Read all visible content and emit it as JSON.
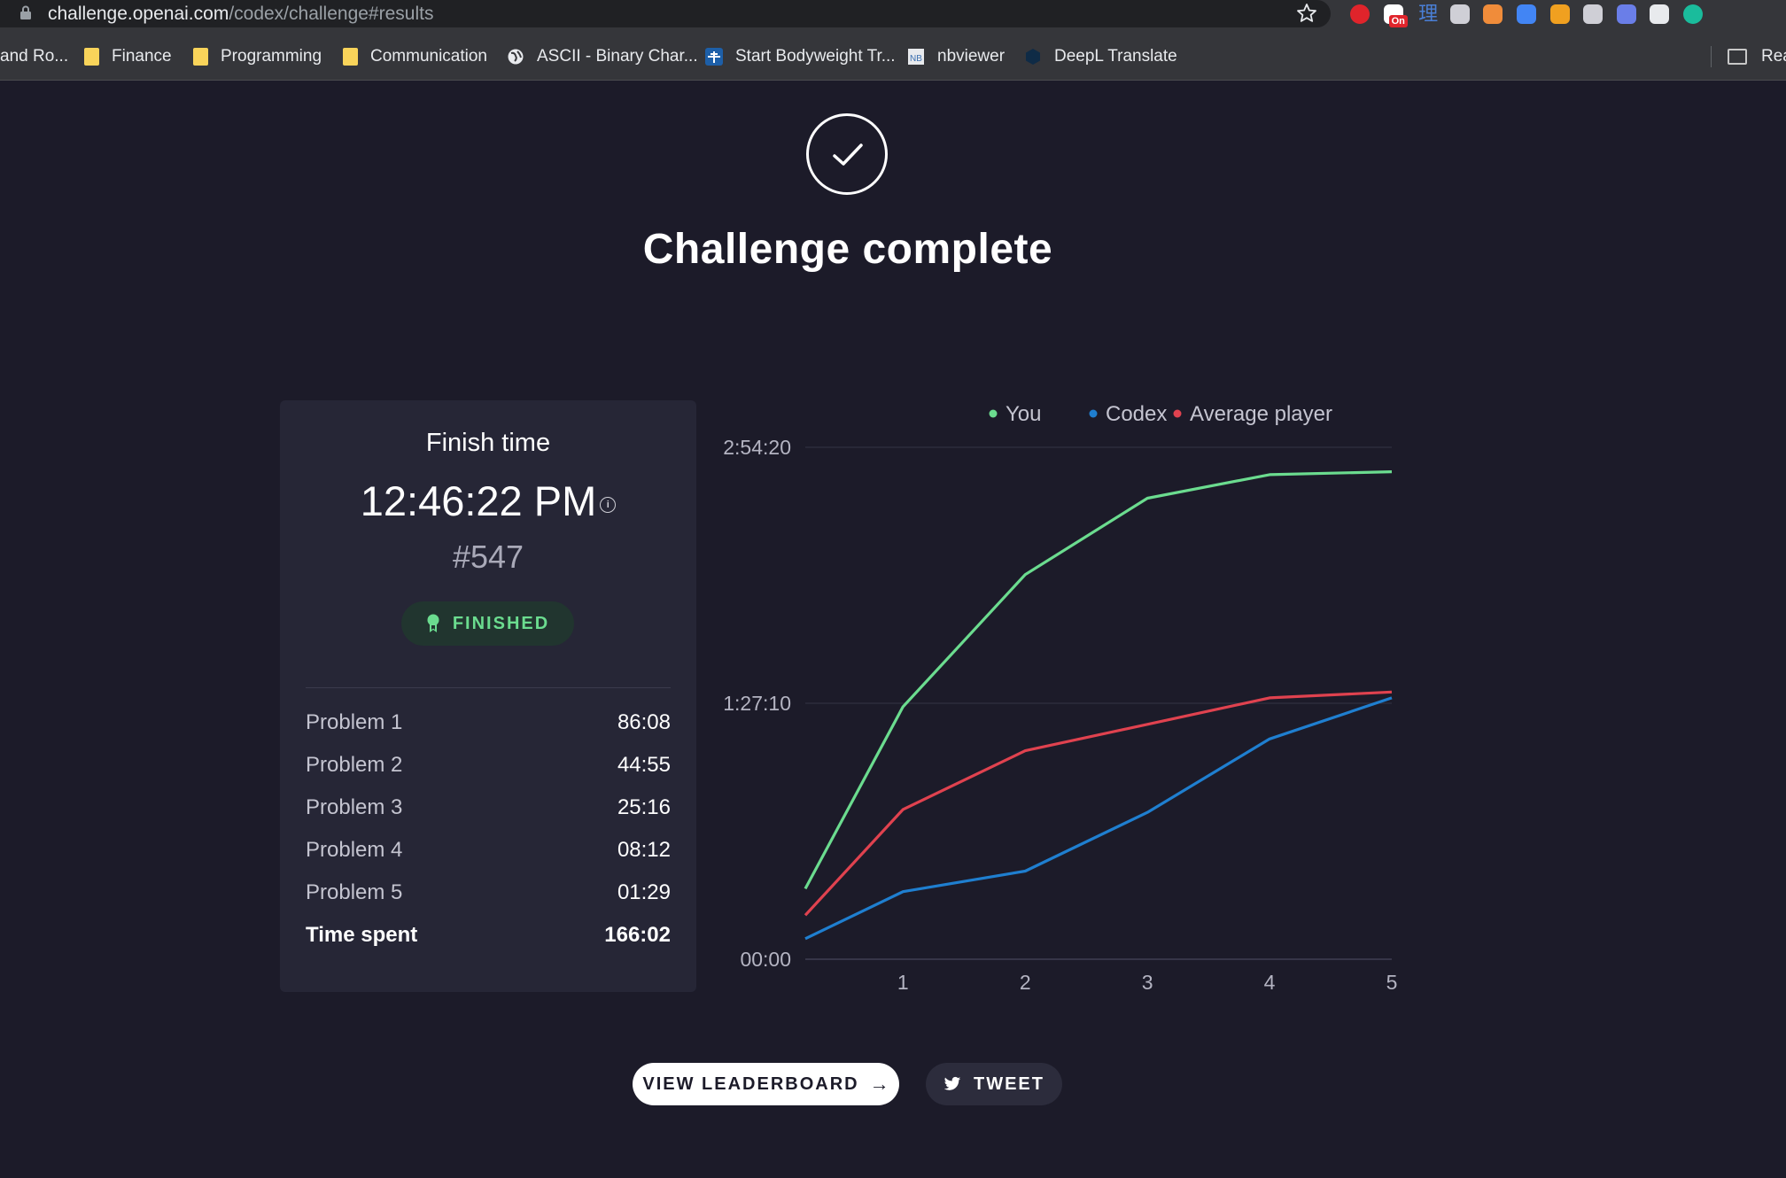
{
  "browser": {
    "url_host": "challenge.openai.com",
    "url_path": "/codex/challenge#results",
    "extensions": [
      {
        "name": "adblock-icon",
        "color": "#e0242b"
      },
      {
        "name": "clip-on-icon",
        "color": "#ffffff",
        "badge": "On"
      },
      {
        "name": "chinese-dictionary-icon",
        "color": "#4a7fd6",
        "glyph": "理"
      },
      {
        "name": "camera-icon",
        "color": "#cfcfd6"
      },
      {
        "name": "eyes-icon",
        "color": "#f08c3a"
      },
      {
        "name": "google-translate-icon",
        "color": "#4285f4"
      },
      {
        "name": "color-wheel-icon",
        "color": "#f0a020"
      },
      {
        "name": "font-icon",
        "color": "#cfcfd6"
      },
      {
        "name": "pen-icon",
        "color": "#6a7ee8"
      },
      {
        "name": "puzzle-extensions-icon",
        "color": "#e8eaed"
      },
      {
        "name": "profile-avatar-icon",
        "color": "#1abc9c"
      }
    ],
    "bookmarks": [
      {
        "label": "and Ro...",
        "icon": "none"
      },
      {
        "label": "Finance",
        "icon": "folder-icon"
      },
      {
        "label": "Programming",
        "icon": "folder-icon"
      },
      {
        "label": "Communication",
        "icon": "folder-icon"
      },
      {
        "label": "ASCII - Binary Char...",
        "icon": "globe-icon"
      },
      {
        "label": "Start Bodyweight Tr...",
        "icon": "bodyweight-icon"
      },
      {
        "label": "nbviewer",
        "icon": "nbviewer-icon"
      },
      {
        "label": "DeepL Translate",
        "icon": "deepl-icon"
      }
    ],
    "reading_list_label": "Read"
  },
  "page": {
    "title": "Challenge complete"
  },
  "card": {
    "title": "Finish time",
    "finish_time": "12:46:22 PM",
    "rank": "#547",
    "status": "FINISHED",
    "status_color": "#6bdc8f",
    "rows": [
      {
        "name": "Problem 1",
        "value": "86:08"
      },
      {
        "name": "Problem 2",
        "value": "44:55"
      },
      {
        "name": "Problem 3",
        "value": "25:16"
      },
      {
        "name": "Problem 4",
        "value": "08:12"
      },
      {
        "name": "Problem 5",
        "value": "01:29"
      }
    ],
    "total": {
      "name": "Time spent",
      "value": "166:02"
    }
  },
  "chart_data": {
    "type": "line",
    "x": [
      0.2,
      1,
      2,
      3,
      4,
      5
    ],
    "x_ticks": [
      "1",
      "2",
      "3",
      "4",
      "5"
    ],
    "y_unit": "minutes",
    "y_ticks": [
      {
        "value": 0,
        "label": "00:00"
      },
      {
        "value": 87.17,
        "label": "1:27:10"
      },
      {
        "value": 174.33,
        "label": "2:54:20"
      }
    ],
    "ylim": [
      0,
      174.33
    ],
    "xlim": [
      0.2,
      5
    ],
    "grid": true,
    "legend": "top-right",
    "series": [
      {
        "name": "You",
        "color": "#6bdc8f",
        "values": [
          24,
          86,
          131,
          157,
          165,
          166
        ]
      },
      {
        "name": "Codex",
        "color": "#1f7fd0",
        "values": [
          7,
          23,
          30,
          50,
          75,
          89
        ]
      },
      {
        "name": "Average player",
        "color": "#e0424f",
        "values": [
          15,
          51,
          71,
          80,
          89,
          91
        ]
      }
    ]
  },
  "actions": {
    "leaderboard_label": "VIEW LEADERBOARD",
    "leaderboard_arrow": "→",
    "tweet_label": "TWEET"
  }
}
